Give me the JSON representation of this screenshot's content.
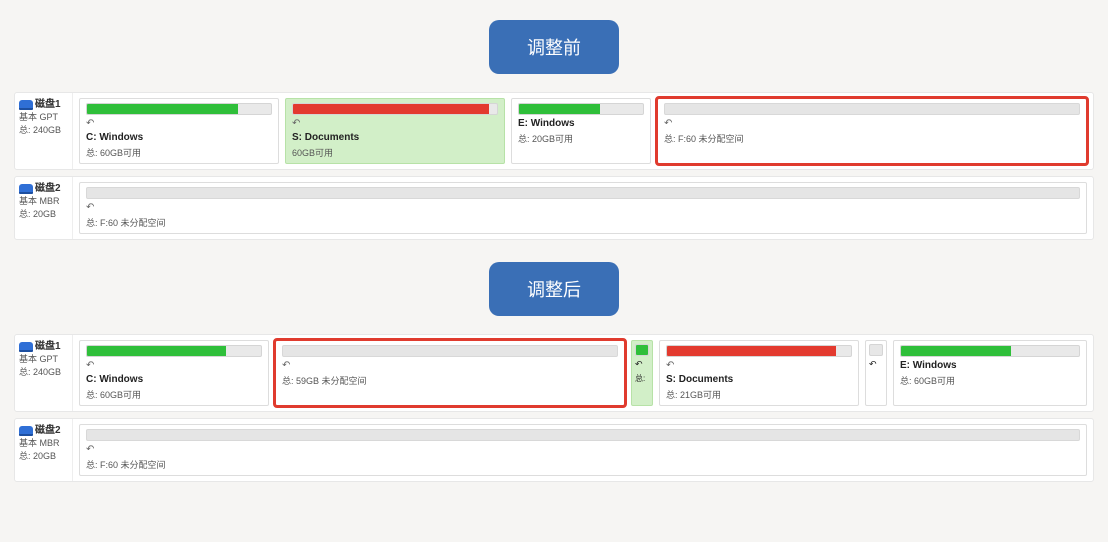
{
  "before": {
    "title": "调整前",
    "disk1": {
      "name": "磁盘1",
      "type": "基本 GPT",
      "total": "总: 240GB",
      "c": {
        "label": "C: Windows",
        "cap": "总: 60GB可用",
        "fill": 82,
        "color": "green"
      },
      "s": {
        "label": "S: Documents",
        "cap": "60GB可用",
        "fill": 96,
        "color": "red"
      },
      "e": {
        "label": "E: Windows",
        "cap": "总: 20GB可用",
        "fill": 65,
        "color": "green"
      },
      "free": {
        "label": "总: F:60 未分配空间"
      }
    },
    "disk2": {
      "name": "磁盘2",
      "type": "基本 MBR",
      "total": "总: 20GB",
      "free": {
        "label": "总: F:60 未分配空间"
      }
    }
  },
  "after": {
    "title": "调整后",
    "disk1": {
      "name": "磁盘1",
      "type": "基本 GPT",
      "total": "总: 240GB",
      "c": {
        "label": "C: Windows",
        "cap": "总: 60GB可用",
        "fill": 80,
        "color": "green"
      },
      "free": {
        "label": "总: 59GB 未分配空间"
      },
      "tiny": {
        "fill": 100,
        "color": "green",
        "meta": "总:"
      },
      "s": {
        "label": "S: Documents",
        "cap": "总: 21GB可用",
        "fill": 92,
        "color": "red"
      },
      "e": {
        "label": "E: Windows",
        "cap": "总: 60GB可用",
        "fill": 62,
        "color": "green"
      }
    },
    "disk2": {
      "name": "磁盘2",
      "type": "基本 MBR",
      "total": "总: 20GB",
      "free": {
        "label": "总: F:60 未分配空间"
      }
    }
  }
}
